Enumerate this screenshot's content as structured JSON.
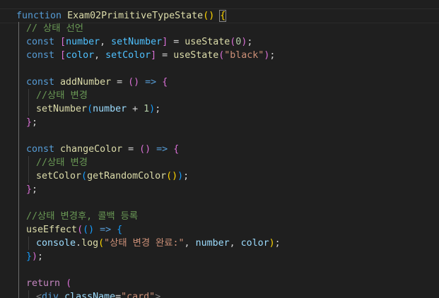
{
  "lines": [
    {
      "indent": 0,
      "tokens": [
        [
          "function",
          "kw"
        ],
        [
          " ",
          "plain"
        ],
        [
          "Exam02PrimitiveTypeState",
          "fn"
        ],
        [
          "(",
          "b1"
        ],
        [
          ")",
          "b1"
        ],
        [
          " ",
          "plain"
        ],
        [
          "{",
          "b1m"
        ]
      ]
    },
    {
      "indent": 1,
      "tokens": [
        [
          "// 상태 선언",
          "com"
        ]
      ]
    },
    {
      "indent": 1,
      "tokens": [
        [
          "const",
          "kw"
        ],
        [
          " ",
          "plain"
        ],
        [
          "[",
          "b2"
        ],
        [
          "number",
          "const"
        ],
        [
          ", ",
          "plain"
        ],
        [
          "setNumber",
          "const"
        ],
        [
          "]",
          "b2"
        ],
        [
          " = ",
          "plain"
        ],
        [
          "useState",
          "fn"
        ],
        [
          "(",
          "b2"
        ],
        [
          "0",
          "num"
        ],
        [
          ")",
          "b2"
        ],
        [
          ";",
          "plain"
        ]
      ]
    },
    {
      "indent": 1,
      "tokens": [
        [
          "const",
          "kw"
        ],
        [
          " ",
          "plain"
        ],
        [
          "[",
          "b2"
        ],
        [
          "color",
          "const"
        ],
        [
          ", ",
          "plain"
        ],
        [
          "setColor",
          "const"
        ],
        [
          "]",
          "b2"
        ],
        [
          " = ",
          "plain"
        ],
        [
          "useState",
          "fn"
        ],
        [
          "(",
          "b2"
        ],
        [
          "\"black\"",
          "str"
        ],
        [
          ")",
          "b2"
        ],
        [
          ";",
          "plain"
        ]
      ]
    },
    {
      "indent": 1,
      "tokens": []
    },
    {
      "indent": 1,
      "tokens": [
        [
          "const",
          "kw"
        ],
        [
          " ",
          "plain"
        ],
        [
          "addNumber",
          "fn"
        ],
        [
          " = ",
          "plain"
        ],
        [
          "()",
          "b2"
        ],
        [
          " ",
          "plain"
        ],
        [
          "=>",
          "kw"
        ],
        [
          " ",
          "plain"
        ],
        [
          "{",
          "b2"
        ]
      ]
    },
    {
      "indent": 2,
      "tokens": [
        [
          "//상태 변경",
          "com"
        ]
      ]
    },
    {
      "indent": 2,
      "tokens": [
        [
          "setNumber",
          "fn"
        ],
        [
          "(",
          "b3"
        ],
        [
          "number",
          "var"
        ],
        [
          " + ",
          "plain"
        ],
        [
          "1",
          "num"
        ],
        [
          ")",
          "b3"
        ],
        [
          ";",
          "plain"
        ]
      ]
    },
    {
      "indent": 1,
      "tokens": [
        [
          "}",
          "b2"
        ],
        [
          ";",
          "plain"
        ]
      ]
    },
    {
      "indent": 1,
      "tokens": []
    },
    {
      "indent": 1,
      "tokens": [
        [
          "const",
          "kw"
        ],
        [
          " ",
          "plain"
        ],
        [
          "changeColor",
          "fn"
        ],
        [
          " = ",
          "plain"
        ],
        [
          "()",
          "b2"
        ],
        [
          " ",
          "plain"
        ],
        [
          "=>",
          "kw"
        ],
        [
          " ",
          "plain"
        ],
        [
          "{",
          "b2"
        ]
      ]
    },
    {
      "indent": 2,
      "tokens": [
        [
          "//상태 변경",
          "com"
        ]
      ]
    },
    {
      "indent": 2,
      "tokens": [
        [
          "setColor",
          "fn"
        ],
        [
          "(",
          "b3"
        ],
        [
          "getRandomColor",
          "fn"
        ],
        [
          "()",
          "b1"
        ],
        [
          ")",
          "b3"
        ],
        [
          ";",
          "plain"
        ]
      ]
    },
    {
      "indent": 1,
      "tokens": [
        [
          "}",
          "b2"
        ],
        [
          ";",
          "plain"
        ]
      ]
    },
    {
      "indent": 1,
      "tokens": []
    },
    {
      "indent": 1,
      "tokens": [
        [
          "//상태 변경후, 콜백 등록",
          "com"
        ]
      ]
    },
    {
      "indent": 1,
      "tokens": [
        [
          "useEffect",
          "fn"
        ],
        [
          "(",
          "b2"
        ],
        [
          "()",
          "b3"
        ],
        [
          " ",
          "plain"
        ],
        [
          "=>",
          "kw"
        ],
        [
          " ",
          "plain"
        ],
        [
          "{",
          "b3"
        ]
      ]
    },
    {
      "indent": 2,
      "tokens": [
        [
          "console",
          "var"
        ],
        [
          ".",
          "plain"
        ],
        [
          "log",
          "fn"
        ],
        [
          "(",
          "b1"
        ],
        [
          "\"상태 변경 완료:\"",
          "str"
        ],
        [
          ", ",
          "plain"
        ],
        [
          "number",
          "var"
        ],
        [
          ", ",
          "plain"
        ],
        [
          "color",
          "var"
        ],
        [
          ")",
          "b1"
        ],
        [
          ";",
          "plain"
        ]
      ]
    },
    {
      "indent": 1,
      "tokens": [
        [
          "}",
          "b3"
        ],
        [
          ")",
          "b2"
        ],
        [
          ";",
          "plain"
        ]
      ]
    },
    {
      "indent": 1,
      "tokens": []
    },
    {
      "indent": 1,
      "tokens": [
        [
          "return",
          "ctrl"
        ],
        [
          " ",
          "plain"
        ],
        [
          "(",
          "b2"
        ]
      ]
    },
    {
      "indent": 2,
      "tokens": [
        [
          "<",
          "tag"
        ],
        [
          "div",
          "tagname"
        ],
        [
          " ",
          "plain"
        ],
        [
          "className",
          "attr"
        ],
        [
          "=",
          "plain"
        ],
        [
          "\"card\"",
          "str"
        ],
        [
          ">",
          "tag"
        ]
      ]
    }
  ]
}
